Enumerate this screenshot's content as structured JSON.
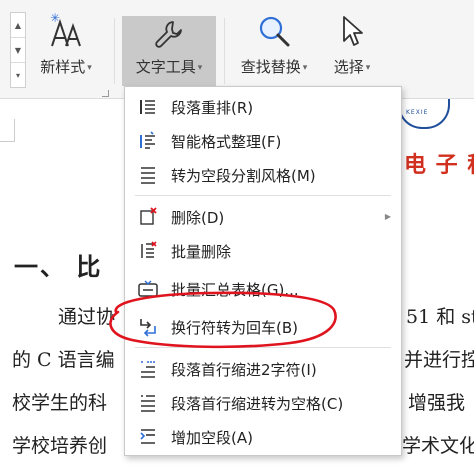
{
  "ribbon": {
    "new_style_label": "新样式",
    "text_tools_label": "文字工具",
    "find_replace_label": "查找替换",
    "select_label": "选择"
  },
  "menu": {
    "items": [
      {
        "label": "段落重排(R)",
        "icon": "paragraph-reflow-icon"
      },
      {
        "label": "智能格式整理(F)",
        "icon": "smart-format-icon"
      },
      {
        "label": "转为空段分割风格(M)",
        "icon": "empty-paragraph-split-icon"
      },
      {
        "label": "删除(D)",
        "icon": "delete-icon",
        "submenu": true
      },
      {
        "label": "批量删除",
        "icon": "batch-delete-icon"
      },
      {
        "label": "批量汇总表格(G)...",
        "icon": "batch-table-icon"
      },
      {
        "label": "换行符转为回车(B)",
        "icon": "linebreak-to-enter-icon"
      },
      {
        "label": "段落首行缩进2字符(I)",
        "icon": "first-line-indent-icon"
      },
      {
        "label": "段落首行缩进转为空格(C)",
        "icon": "indent-to-space-icon"
      },
      {
        "label": "增加空段(A)",
        "icon": "add-empty-paragraph-icon"
      }
    ]
  },
  "document": {
    "heading": "一、 比",
    "brand_text": "电 子 科",
    "logo_text": "KEXIE",
    "lines": [
      {
        "left": "通过协",
        "right": "51 和 st"
      },
      {
        "left": "的 C 语言编",
        "right": "并进行控"
      },
      {
        "left": "校学生的科",
        "right": "增强我"
      },
      {
        "left": "学校培养创",
        "right": "学术文化"
      }
    ]
  },
  "colors": {
    "accent_blue": "#2f6fd6",
    "annotation_red": "#e0141e",
    "ribbon_bg": "#f5f5f5",
    "pressed_button": "#c9c9c9",
    "brand_red": "#d1301f"
  }
}
